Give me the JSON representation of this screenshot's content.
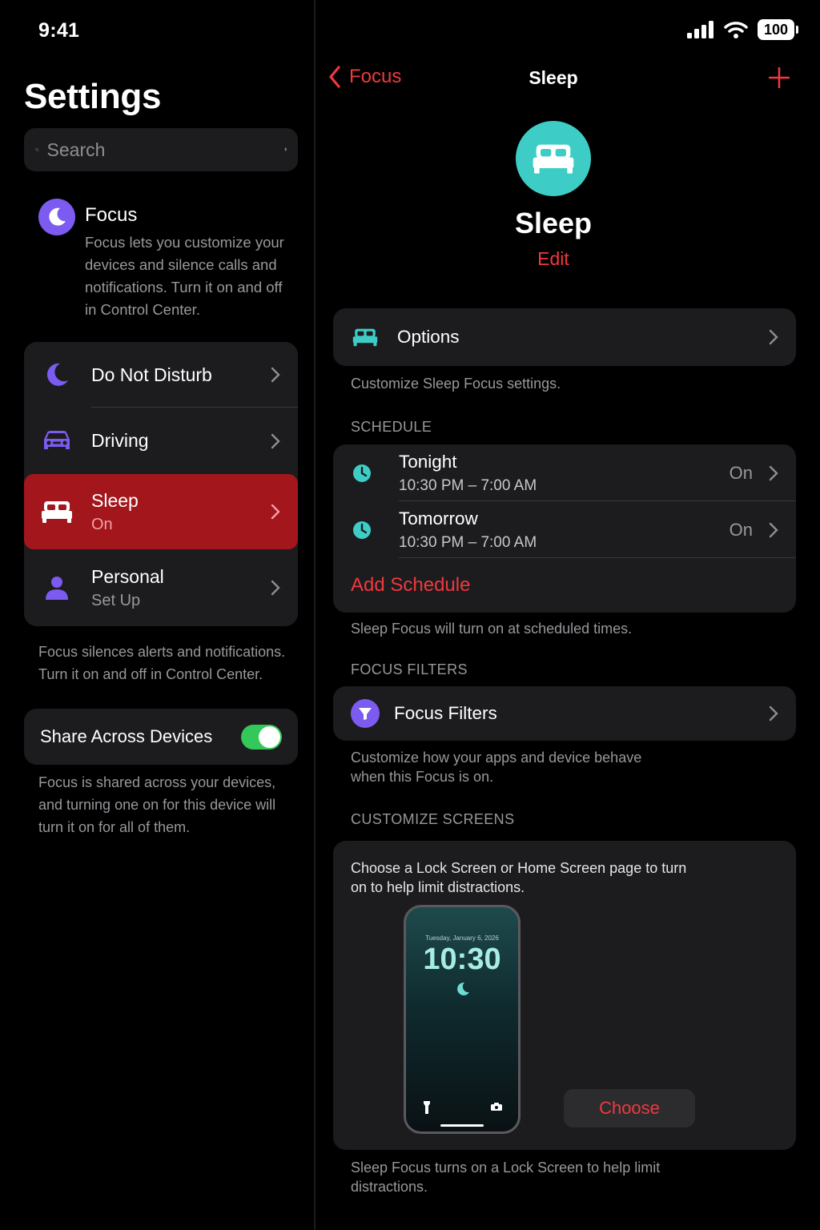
{
  "status_bar": {
    "time": "9:41",
    "battery": "100"
  },
  "left": {
    "title": "Settings",
    "search_placeholder": "Search",
    "focus": {
      "title": "Focus",
      "description": "Focus lets you customize your devices and silence calls and notifications. Turn it on and off in Control Center."
    },
    "modes": [
      {
        "label": "Do Not Disturb",
        "subtitle": ""
      },
      {
        "label": "Driving",
        "subtitle": ""
      },
      {
        "label": "Sleep",
        "subtitle": "On"
      },
      {
        "label": "Personal",
        "subtitle": "Set Up"
      }
    ],
    "modes_footnote": "Focus silences alerts and notifications. Turn it on and off in Control Center.",
    "share_label": "Share Across Devices",
    "share_footnote": "Focus is shared across your devices, and turning one on for this device will turn it on for all of them."
  },
  "right": {
    "nav": {
      "back_label": "Focus",
      "title": "Sleep"
    },
    "hero": {
      "title": "Sleep",
      "edit_label": "Edit"
    },
    "options": {
      "label": "Options",
      "caption": "Customize Sleep Focus settings."
    },
    "schedule": {
      "header": "SCHEDULE",
      "items": [
        {
          "label": "Tonight",
          "time": "10:30 PM – 7:00 AM",
          "state": "On"
        },
        {
          "label": "Tomorrow",
          "time": "10:30 PM – 7:00 AM",
          "state": "On"
        }
      ],
      "add_label": "Add Schedule",
      "caption": "Sleep Focus will turn on at scheduled times."
    },
    "filters": {
      "header": "FOCUS FILTERS",
      "label": "Focus Filters",
      "caption": "Customize how your apps and device behave when this Focus is on."
    },
    "screens": {
      "header": "CUSTOMIZE SCREENS",
      "description": "Choose a Lock Screen or Home Screen page to turn on to help limit distractions.",
      "preview_date": "Tuesday, January 6, 2026",
      "preview_time": "10:30",
      "choose_label": "Choose",
      "caption": "Sleep Focus turns on a Lock Screen to help limit distractions."
    }
  },
  "colors": {
    "accent_red": "#f0383e",
    "active_row": "#a3161c",
    "focus_purple": "#7b5bf0",
    "sleep_teal": "#3ecdc6",
    "toggle_green": "#34c759"
  }
}
